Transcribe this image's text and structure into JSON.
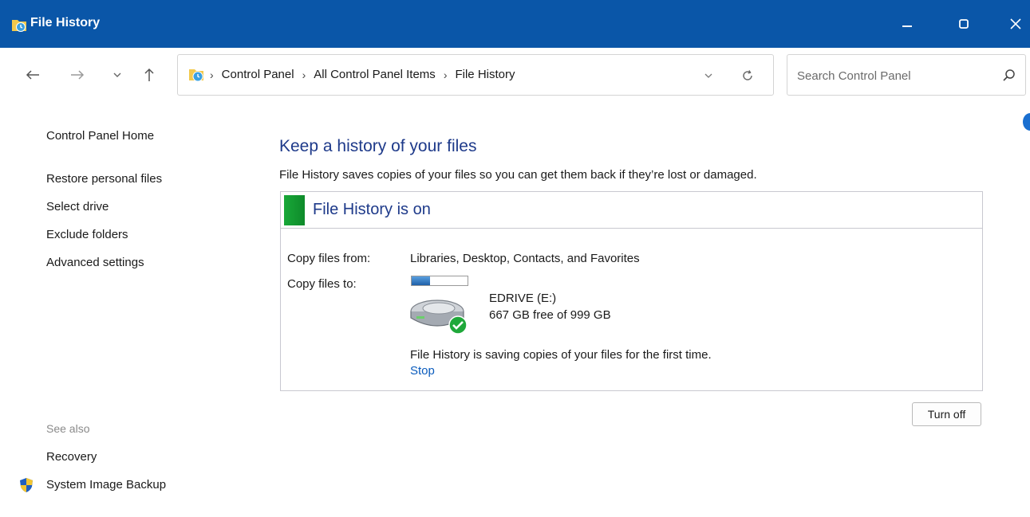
{
  "window": {
    "title": "File History",
    "controls": {
      "minimize": "minimize",
      "maximize": "maximize",
      "close": "close"
    }
  },
  "nav": {
    "back_icon": "back-arrow-icon",
    "forward_icon": "forward-arrow-icon",
    "recent_icon": "chevron-down-icon",
    "up_icon": "up-arrow-icon"
  },
  "address": {
    "breadcrumbs": [
      "Control Panel",
      "All Control Panel Items",
      "File History"
    ],
    "separator": "›"
  },
  "search": {
    "placeholder": "Search Control Panel"
  },
  "left_pane": {
    "links": [
      "Control Panel Home",
      "Restore personal files",
      "Select drive",
      "Exclude folders",
      "Advanced settings"
    ],
    "see_also_label": "See also",
    "see_also_links": [
      "Recovery",
      "System Image Backup"
    ]
  },
  "main": {
    "heading": "Keep a history of your files",
    "description": "File History saves copies of your files so you can get them back if they’re lost or damaged.",
    "status": {
      "title": "File History is on",
      "copy_from_label": "Copy files from:",
      "copy_from_value": "Libraries, Desktop, Contacts, and Favorites",
      "copy_to_label": "Copy files to:",
      "drive_name": "EDRIVE (E:)",
      "drive_free": "667 GB free of 999 GB",
      "drive_used_fraction": 0.33,
      "saving_message": "File History is saving copies of your files for the first time.",
      "stop_label": "Stop"
    },
    "turn_off_label": "Turn off"
  },
  "colors": {
    "titlebar": "#0a56a8",
    "heading": "#1e3a8a",
    "link": "#0b5cbd",
    "status_green": "#18a838"
  }
}
